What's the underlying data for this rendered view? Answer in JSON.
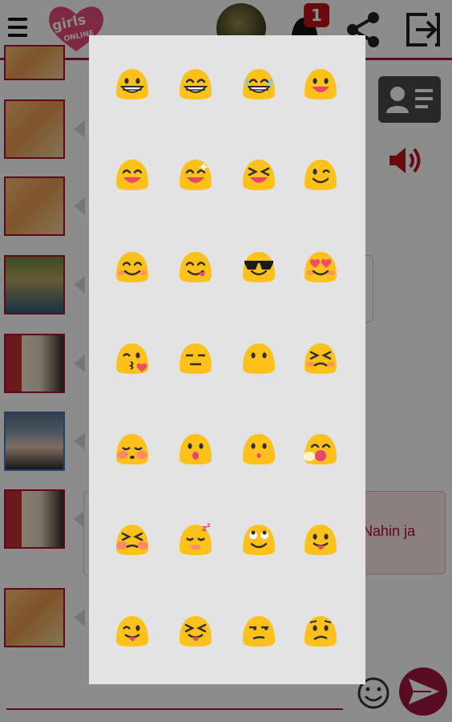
{
  "header": {
    "logo_text": "girls ONLINE",
    "notification_count": "1",
    "icons": [
      "menu-icon",
      "logo",
      "avatar",
      "notification-bell-icon",
      "share-icon",
      "exit-icon"
    ]
  },
  "chat": {
    "visible_message_text": "Nahin ja",
    "right_icons": [
      "contact-card-icon",
      "speaker-icon"
    ]
  },
  "composer": {
    "icons": [
      "smiley-icon",
      "send-icon"
    ]
  },
  "emoji_picker": {
    "rows": [
      [
        "grin-teeth",
        "grin-squint",
        "grin-sweat",
        "smile-open"
      ],
      [
        "laugh-closed-eyes",
        "smile-sparkle",
        "squint-laugh",
        "wink"
      ],
      [
        "blush-smile",
        "yum-tongue",
        "cool-sunglasses",
        "heart-eyes"
      ],
      [
        "kiss-heart",
        "expressionless",
        "no-mouth",
        "persevere"
      ],
      [
        "sleepy-blush",
        "open-mouth",
        "hushed",
        "yawn"
      ],
      [
        "tired-squint",
        "sleeping-zzz",
        "rolling-eyes",
        "tongue-out"
      ],
      [
        "tongue-wink",
        "tongue-squint",
        "unamused",
        "confused"
      ]
    ],
    "colors": {
      "face": "#fcc21b",
      "blush": "#ff8a65",
      "dark": "#2f2f2f",
      "tongue": "#e94570"
    }
  }
}
